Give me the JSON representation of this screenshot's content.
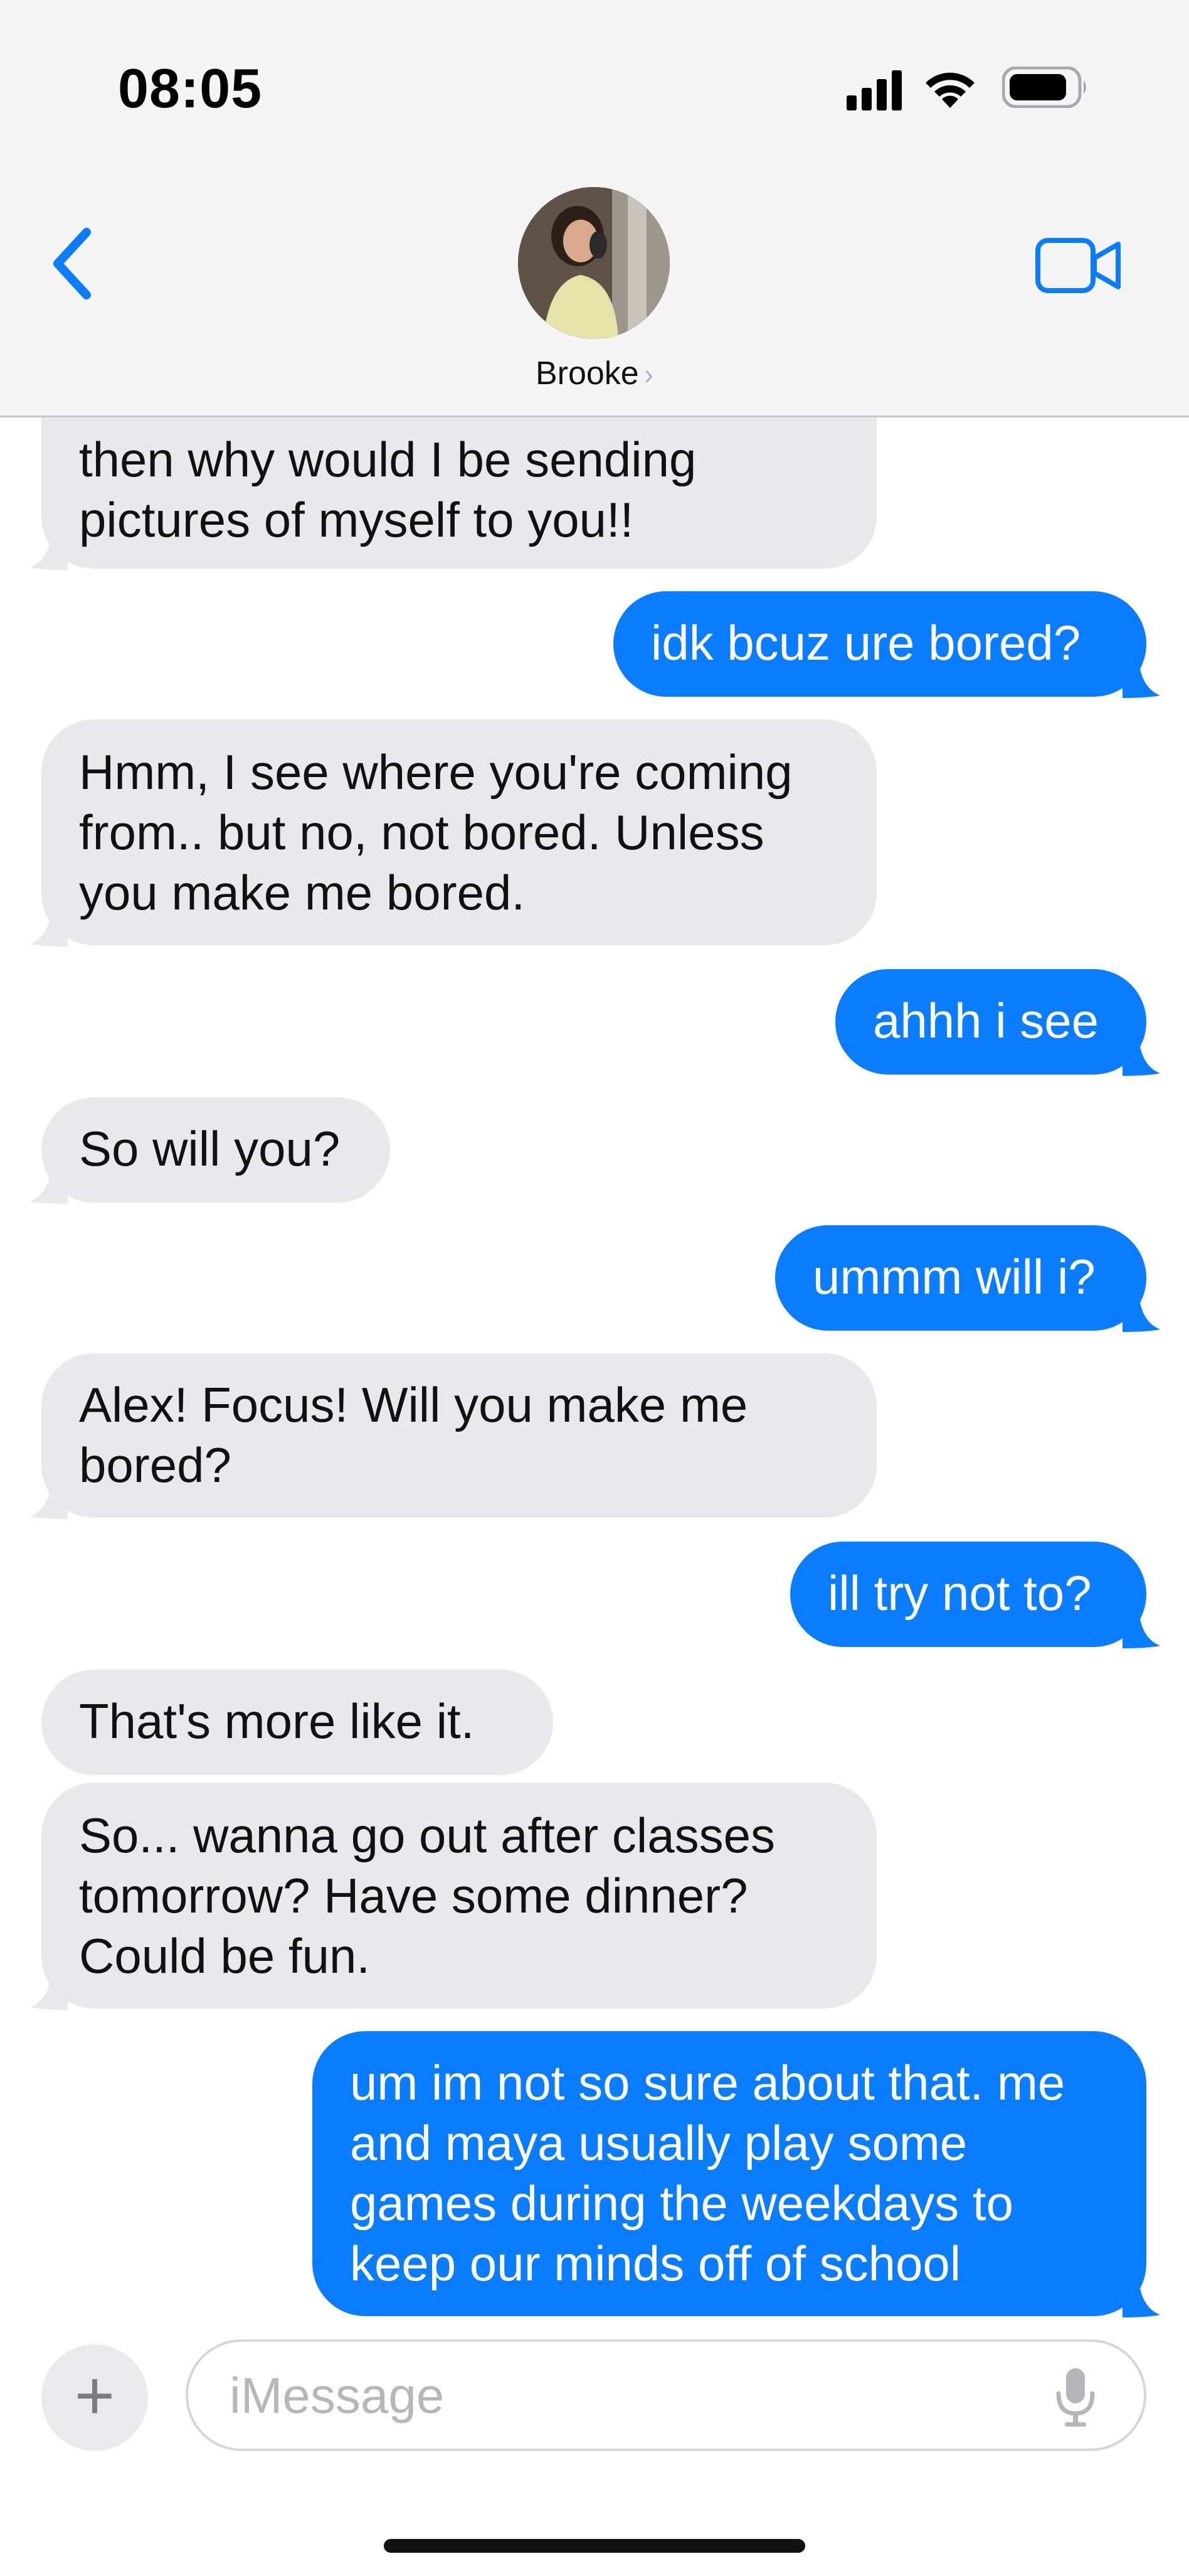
{
  "status_bar": {
    "time": "08:05"
  },
  "header": {
    "contact_name": "Brooke",
    "chevron": "›"
  },
  "messages": [
    {
      "from": "them",
      "text": "then why would I be sending pictures of myself to you!!"
    },
    {
      "from": "me",
      "text": "idk bcuz ure bored?"
    },
    {
      "from": "them",
      "text": "Hmm, I see where you're coming from.. but no, not bored. Unless you make me bored."
    },
    {
      "from": "me",
      "text": "ahhh i see"
    },
    {
      "from": "them",
      "text": "So will you?"
    },
    {
      "from": "me",
      "text": "ummm will i?"
    },
    {
      "from": "them",
      "text": "Alex! Focus! Will you make me bored?"
    },
    {
      "from": "me",
      "text": "ill try not to?"
    },
    {
      "from": "them",
      "text": "That's more like it."
    },
    {
      "from": "them",
      "text": "So... wanna go out after classes tomorrow? Have some dinner? Could be fun."
    },
    {
      "from": "me",
      "text": "um im not so sure about that. me and maya usually play some games during the weekdays to keep our minds off of school"
    }
  ],
  "composer": {
    "placeholder": "iMessage",
    "value": "",
    "plus": "+"
  },
  "colors": {
    "outgoing": "#0a7cff",
    "incoming": "#e9e9eb",
    "accent": "#0a7cff"
  },
  "icons": [
    "signal-icon",
    "wifi-icon",
    "battery-icon",
    "back-chevron-icon",
    "video-call-icon",
    "plus-icon",
    "microphone-icon"
  ]
}
